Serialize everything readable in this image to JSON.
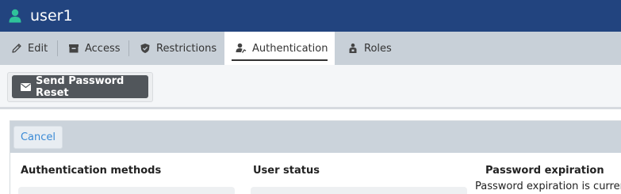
{
  "header": {
    "title": "user1",
    "icon": "user-icon"
  },
  "tabs": [
    {
      "label": "Edit",
      "icon": "pencil-icon",
      "active": false
    },
    {
      "label": "Access",
      "icon": "inbox-icon",
      "active": false
    },
    {
      "label": "Restrictions",
      "icon": "shield-icon",
      "active": false
    },
    {
      "label": "Authentication",
      "icon": "user-key-icon",
      "active": true
    },
    {
      "label": "Roles",
      "icon": "roles-icon",
      "active": false
    }
  ],
  "toolbar": {
    "send_reset_label": "Send Password Reset",
    "send_reset_icon": "envelope-icon"
  },
  "panel": {
    "cancel_label": "Cancel",
    "columns": {
      "auth_methods": "Authentication methods",
      "user_status": "User status",
      "password_expiration": "Password expiration"
    },
    "password_expiration_text": "Password expiration is current"
  },
  "colors": {
    "header_bg": "#22447f",
    "user_icon": "#2fc29a",
    "tabbar_bg": "#c8d0d8",
    "button_dark": "#51565b",
    "link_blue": "#3a8ad6"
  }
}
